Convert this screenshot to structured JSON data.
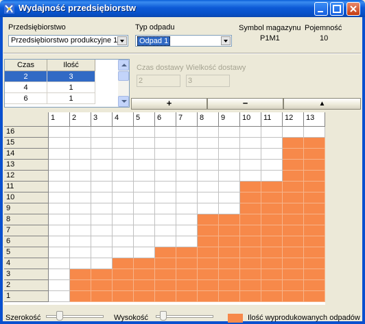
{
  "window": {
    "title": "Wydajność przedsiębiorstw",
    "icon": "app-logo-icon"
  },
  "controls": {
    "enterprise_label": "Przedsiębiorstwo",
    "enterprise_value": "Przedsiębiorstwo produkcyjne 1",
    "waste_type_label": "Typ odpadu",
    "waste_type_value": "Odpad 1",
    "warehouse_symbol_label": "Symbol magazynu",
    "warehouse_symbol_value": "P1M1",
    "capacity_label": "Pojemność",
    "capacity_value": "10"
  },
  "list": {
    "headers": [
      "Czas",
      "Ilość"
    ],
    "rows": [
      [
        "2",
        "3"
      ],
      [
        "4",
        "1"
      ],
      [
        "6",
        "1"
      ]
    ],
    "selected_row": 0
  },
  "delivery": {
    "time_label": "Czas dostawy",
    "time_value": "2",
    "size_label": "Wielkość dostawy",
    "size_value": "3"
  },
  "buttons": {
    "add": "+",
    "remove": "−",
    "up": "▲"
  },
  "grid": {
    "columns": [
      "1",
      "2",
      "3",
      "4",
      "5",
      "6",
      "7",
      "8",
      "9",
      "10",
      "11",
      "12",
      "13"
    ],
    "rows": [
      "16",
      "15",
      "14",
      "13",
      "12",
      "11",
      "10",
      "9",
      "8",
      "7",
      "6",
      "5",
      "4",
      "3",
      "2",
      "1"
    ],
    "fill_color": "#f7894a",
    "filled_levels": [
      0,
      3,
      3,
      4,
      4,
      5,
      5,
      8,
      8,
      11,
      11,
      15,
      15
    ]
  },
  "bottom": {
    "width_label": "Szerokość",
    "height_label": "Wysokość",
    "legend_label": "Ilość wyprodukowanych odpadów",
    "legend_color": "#f7894a"
  }
}
